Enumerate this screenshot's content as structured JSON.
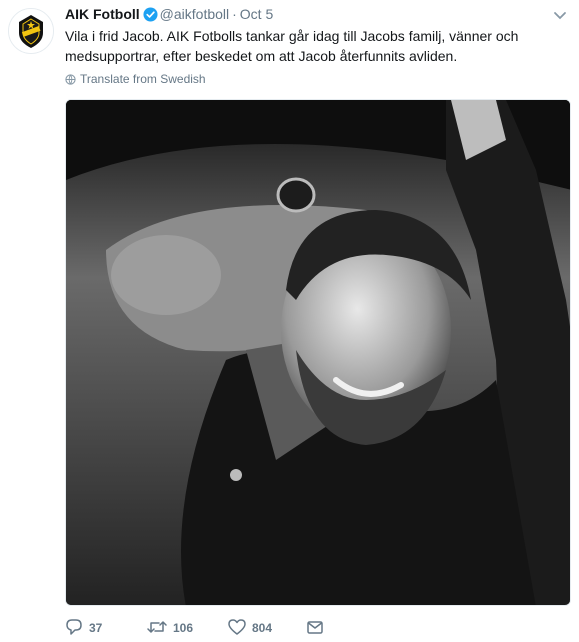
{
  "tweet": {
    "author_name": "AIK Fotboll",
    "handle": "@aikfotboll",
    "separator": "·",
    "date": "Oct 5",
    "text": "Vila i frid Jacob. AIK Fotbolls tankar går idag till Jacobs familj, vänner och medsupportrar, efter beskedet om att Jacob återfunnits avliden.",
    "translate_label": "Translate from Swedish"
  },
  "actions": {
    "replies": "37",
    "retweets": "106",
    "likes": "804"
  },
  "colors": {
    "verified": "#1da1f2",
    "muted": "#657786",
    "badge_black": "#111111",
    "badge_yellow": "#f2c511"
  },
  "icons": [
    "verified-icon",
    "chevron-down-icon",
    "globe-icon",
    "reply-icon",
    "retweet-icon",
    "like-icon",
    "message-icon"
  ]
}
